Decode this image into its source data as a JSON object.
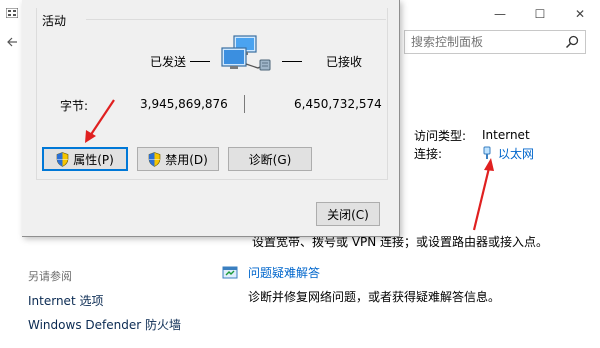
{
  "background_window": {
    "window_controls": {
      "minimize": "—",
      "maximize": "☐",
      "close": "✕"
    },
    "search": {
      "placeholder": "搜索控制面板"
    },
    "connection": {
      "access_type_label": "访问类型:",
      "access_type_value": "Internet",
      "connections_label": "连接:",
      "connections_value": "以太网"
    },
    "description": "设置宽带、拨号或 VPN 连接；或设置路由器或接入点。",
    "see_also": {
      "heading": "另请参阅",
      "links": [
        "Internet 选项",
        "Windows Defender 防火墙"
      ]
    },
    "troubleshoot": {
      "link": "问题疑难解答",
      "description": "诊断并修复网络问题，或者获得疑难解答信息。"
    }
  },
  "dialog": {
    "activity_title": "活动",
    "sent_label": "已发送",
    "received_label": "已接收",
    "bytes_label": "字节:",
    "bytes_sent": "3,945,869,876",
    "bytes_received": "6,450,732,574",
    "buttons": {
      "properties": "属性(P)",
      "disable": "禁用(D)",
      "diagnose": "诊断(G)",
      "close": "关闭(C)"
    }
  },
  "colors": {
    "link": "#0066cc",
    "annotation": "#e02020",
    "focus": "#0078d7"
  }
}
